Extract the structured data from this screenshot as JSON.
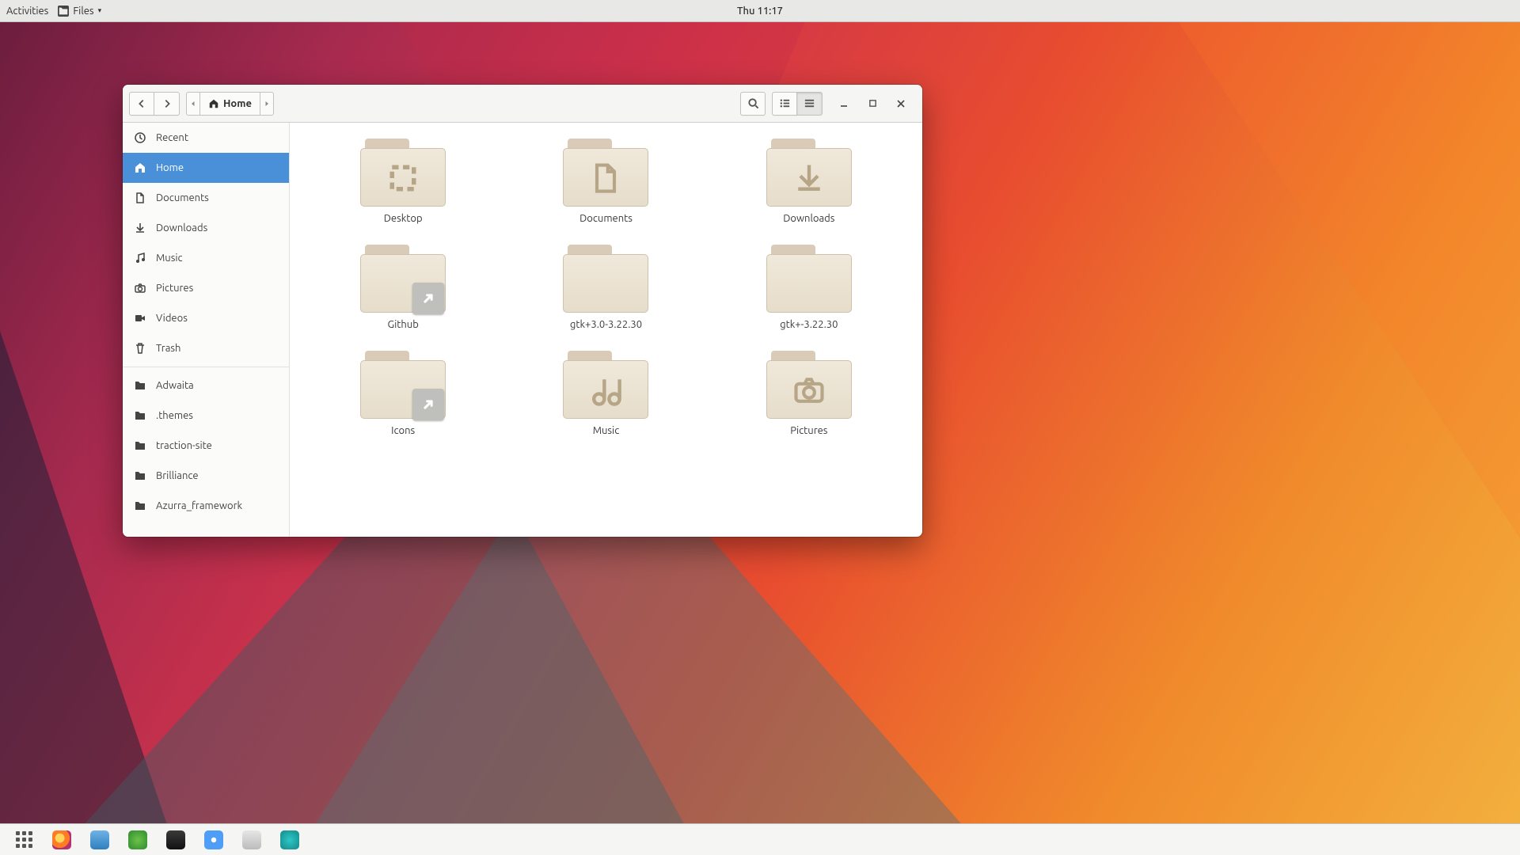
{
  "topbar": {
    "activities": "Activities",
    "app_menu_label": "Files",
    "clock": "Thu 11:17"
  },
  "window": {
    "path_label": "Home"
  },
  "sidebar": {
    "places": [
      {
        "id": "recent",
        "label": "Recent",
        "icon": "clock"
      },
      {
        "id": "home",
        "label": "Home",
        "icon": "home"
      },
      {
        "id": "documents",
        "label": "Documents",
        "icon": "doc"
      },
      {
        "id": "downloads",
        "label": "Downloads",
        "icon": "download"
      },
      {
        "id": "music",
        "label": "Music",
        "icon": "music"
      },
      {
        "id": "pictures",
        "label": "Pictures",
        "icon": "camera"
      },
      {
        "id": "videos",
        "label": "Videos",
        "icon": "video"
      },
      {
        "id": "trash",
        "label": "Trash",
        "icon": "trash"
      }
    ],
    "bookmarks": [
      {
        "id": "adwaita",
        "label": "Adwaita"
      },
      {
        "id": "themes",
        "label": ".themes"
      },
      {
        "id": "traction",
        "label": "traction-site"
      },
      {
        "id": "brilliance",
        "label": "Brilliance"
      },
      {
        "id": "azurra",
        "label": "Azurra_framework"
      }
    ],
    "selected": "home"
  },
  "folders": [
    {
      "name": "Desktop",
      "glyph": "desktop",
      "emblem": null
    },
    {
      "name": "Documents",
      "glyph": "doc",
      "emblem": null
    },
    {
      "name": "Downloads",
      "glyph": "download",
      "emblem": null
    },
    {
      "name": "Github",
      "glyph": null,
      "emblem": "link"
    },
    {
      "name": "gtk+3.0-3.22.30",
      "glyph": null,
      "emblem": null
    },
    {
      "name": "gtk+-3.22.30",
      "glyph": null,
      "emblem": null
    },
    {
      "name": "Icons",
      "glyph": null,
      "emblem": "link"
    },
    {
      "name": "Music",
      "glyph": "music",
      "emblem": null
    },
    {
      "name": "Pictures",
      "glyph": "camera",
      "emblem": null
    }
  ],
  "dash": {
    "apps": [
      {
        "id": "firefox",
        "name": "firefox-icon"
      },
      {
        "id": "files",
        "name": "files-icon"
      },
      {
        "id": "midori",
        "name": "midori-icon"
      },
      {
        "id": "terminal",
        "name": "terminal-icon"
      },
      {
        "id": "chromium",
        "name": "chromium-icon"
      },
      {
        "id": "vm",
        "name": "boxes-icon"
      },
      {
        "id": "rhythmbox",
        "name": "rhythmbox-icon"
      }
    ]
  }
}
